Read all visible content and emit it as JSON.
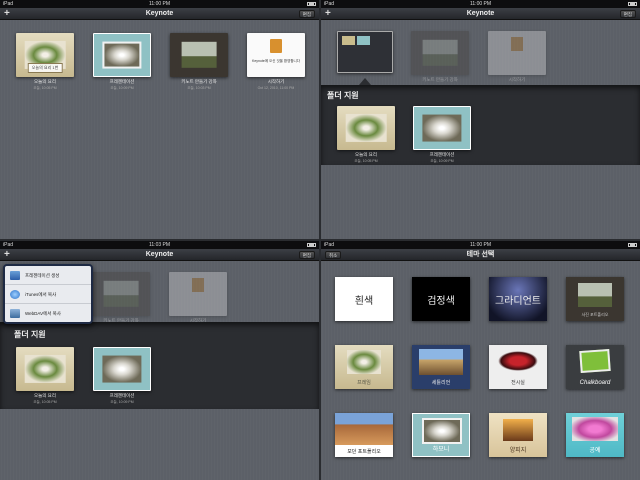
{
  "status": {
    "carrier": "iPad",
    "clock_a": "11:00 PM",
    "clock_b": "11:03 PM"
  },
  "navbar": {
    "title": "Keynote",
    "add": "+",
    "edit": "편집",
    "cancel": "취소",
    "theme_title": "테마 선택"
  },
  "docs": [
    {
      "name": "오늘의 요리",
      "date": "오늘, 10:05 PM",
      "theme": "cook",
      "inner": "오늘의 요리 1번"
    },
    {
      "name": "프레젠테이션",
      "date": "오늘, 10:09 PM",
      "theme": "dandelion"
    },
    {
      "name": "키노트 만들기 강좌",
      "date": "오늘, 10:03 PM",
      "theme": "tree"
    },
    {
      "name": "시작하기",
      "date": "Oct 12, 2010, 11:00 PM",
      "theme": "start",
      "inner": "Keynote에 오신 것을 환영합니다"
    }
  ],
  "folder": {
    "name": "폴더 지원"
  },
  "popover": {
    "items": [
      {
        "label": "프레젠테이션 생성",
        "icon": "new-presentation-icon"
      },
      {
        "label": "iTunes에서 복사",
        "icon": "itunes-icon"
      },
      {
        "label": "WebDAV에서 복사",
        "icon": "webdav-icon"
      }
    ]
  },
  "themes": [
    "흰색",
    "검정색",
    "그라디언트",
    "사진 포트폴리오",
    "프레임",
    "세틀리언",
    "전시실",
    "Chalkboard",
    "모던 포트폴리오",
    "하모니",
    "양피지",
    "공예"
  ],
  "colors": {
    "folder_bar": "#2b2d31",
    "popover_border": "#1e2a44",
    "text_light": "#e8e8e8"
  }
}
